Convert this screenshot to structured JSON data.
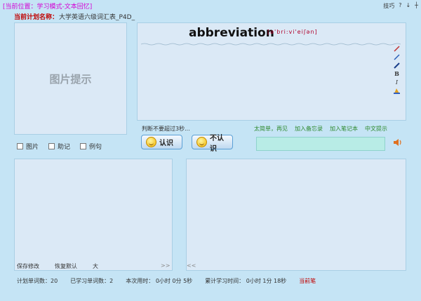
{
  "location": "[当前位置：学习模式-文本回忆]",
  "top_right": {
    "tips": "技巧",
    "help": "?",
    "min": "↓",
    "close": "┼"
  },
  "plan": {
    "label": "当前计划名称：",
    "value": "大学英语六级词汇表_P4D_"
  },
  "image_hint": "图片提示",
  "word": "abbreviation",
  "phonetic": "[ə'bri:vi'eiʃən]",
  "judge_hint": "判断不要超过3秒...",
  "links": [
    "太简单，再见",
    "加入备忘录",
    "加入笔记本",
    "中文提示"
  ],
  "checks": [
    "图片",
    "助记",
    "例句"
  ],
  "buttons": {
    "know": "认识",
    "unknow": "不认识"
  },
  "left_actions": [
    "保存修改",
    "恢复默认",
    "大"
  ],
  "left_arrow": ">>",
  "right_arrow": "<<",
  "status": {
    "plan_words": "计划单词数：20",
    "learned_words": "已学习单词数：2",
    "this_time": "本次用时：  0小时 0分 5秒",
    "total_time": "累计学习时间：  0小时 1分 18秒",
    "current_label": "当前笔"
  },
  "tool_icons": [
    "pencil-icon",
    "pen-icon",
    "marker-icon",
    "bold-icon",
    "italic-icon",
    "color-icon"
  ],
  "colors": {
    "background": "#c5e4f5",
    "panel": "#dbe9f6",
    "link": "#2e8a2e",
    "accent_red": "#c00000",
    "location": "#d400d4"
  }
}
